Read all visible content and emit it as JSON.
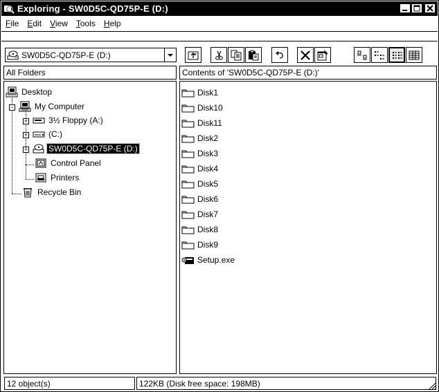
{
  "window": {
    "title": "Exploring - SW0D5C-QD75P-E (D:)"
  },
  "menu": [
    {
      "key": "F",
      "rest": "ile"
    },
    {
      "key": "E",
      "rest": "dit"
    },
    {
      "key": "V",
      "rest": "iew"
    },
    {
      "key": "T",
      "rest": "ools"
    },
    {
      "key": "H",
      "rest": "elp"
    }
  ],
  "address": {
    "value": "SW0D5C-QD75P-E (D:)"
  },
  "toolbar_icons": [
    "up-folder-icon",
    "cut-icon",
    "copy-icon",
    "paste-icon",
    "undo-icon",
    "delete-icon",
    "properties-icon",
    "large-icons-view-icon",
    "small-icons-view-icon",
    "list-view-icon",
    "details-view-icon"
  ],
  "left_header": "All Folders",
  "right_header": "Contents of 'SW0D5C-QD75P-E (D:)'",
  "tree": {
    "desktop": "Desktop",
    "my_computer": "My Computer",
    "floppy": "3½ Floppy (A:)",
    "c_drive": "(C:)",
    "d_drive": "SW0D5C-QD75P-E (D:)",
    "control_panel": "Control Panel",
    "printers": "Printers",
    "recycle_bin": "Recycle Bin"
  },
  "files": [
    "Disk1",
    "Disk10",
    "Disk11",
    "Disk2",
    "Disk3",
    "Disk4",
    "Disk5",
    "Disk6",
    "Disk7",
    "Disk8",
    "Disk9",
    "Setup.exe"
  ],
  "status": {
    "objects": "12 object(s)",
    "space": "122KB (Disk free space: 198MB)"
  },
  "colors": {
    "title_bg": "#000000",
    "selection_bg": "#000000"
  }
}
